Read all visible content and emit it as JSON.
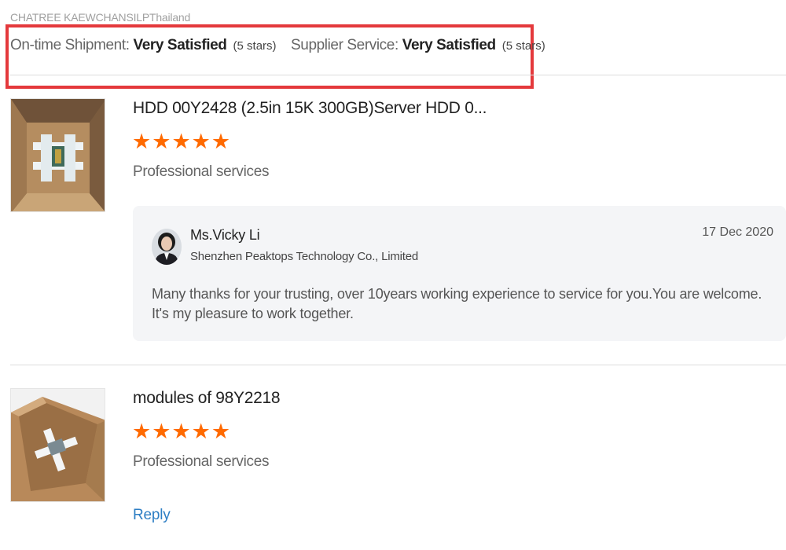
{
  "reviewer": {
    "name_country": "CHATREE KAEWCHANSILPThailand"
  },
  "ratings": {
    "on_time_shipment": {
      "label": "On-time Shipment:",
      "value": "Very Satisfied",
      "stars_note": "(5 stars)"
    },
    "supplier_service": {
      "label": "Supplier Service:",
      "value": "Very Satisfied",
      "stars_note": "(5 stars)"
    }
  },
  "highlight_color": "#e4393c",
  "star_color": "#ff6a00",
  "link_color": "#2d7ec4",
  "reviews": [
    {
      "product_title": "HDD 00Y2428 (2.5in 15K 300GB)Server HDD 0...",
      "rating_stars": 5,
      "feedback": "Professional services",
      "thumbnail_icon": "open-box-with-hdd-image",
      "reply": {
        "name": "Ms.Vicky Li",
        "company": "Shenzhen Peaktops Technology Co., Limited",
        "date": "17 Dec 2020",
        "message_line1": "Many thanks for your trusting, over  10years working experience to service for you.You are welcome.",
        "message_line2": "It's my pleasure to work together."
      }
    },
    {
      "product_title": "modules of 98Y2218",
      "rating_stars": 5,
      "feedback": "Professional services",
      "thumbnail_icon": "open-box-with-module-image",
      "reply_link": "Reply"
    }
  ]
}
